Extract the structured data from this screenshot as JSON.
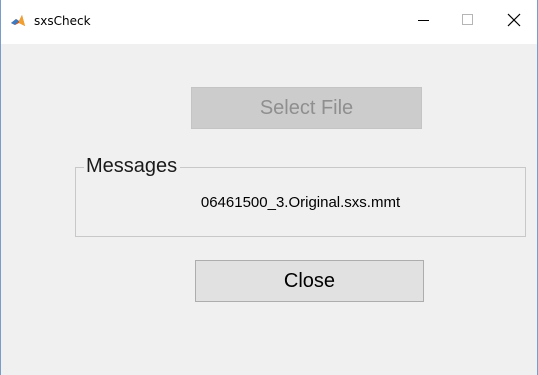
{
  "window": {
    "title": "sxsCheck",
    "app_icon": "matlab-icon",
    "controls": {
      "minimize_icon": "minimize-icon",
      "maximize_icon": "maximize-icon",
      "close_icon": "close-icon"
    }
  },
  "main": {
    "select_file_label": "Select File",
    "select_file_enabled": false,
    "messages": {
      "title": "Messages",
      "text": "06461500_3.Original.sxs.mmt"
    },
    "close_label": "Close"
  },
  "colors": {
    "background": "#f0f0f0",
    "titlebar": "#ffffff",
    "disabled_button": "#cccccc",
    "disabled_text": "#8f8f8f",
    "button": "#e1e1e1"
  }
}
